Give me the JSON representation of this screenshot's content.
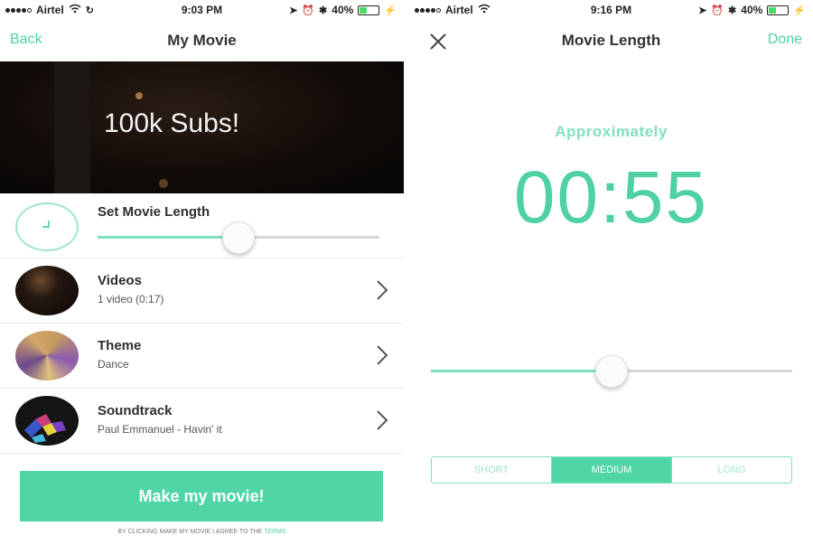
{
  "left": {
    "status": {
      "carrier": "Airtel",
      "time": "9:03 PM",
      "battery": "40%",
      "battery_level": 0.4
    },
    "nav": {
      "back_label": "Back",
      "title": "My Movie"
    },
    "hero": {
      "text": "100k Subs!"
    },
    "length": {
      "label": "Set Movie Length",
      "slider_value": 0.5,
      "icon": "clock-icon"
    },
    "rows": [
      {
        "title": "Videos",
        "subtitle": "1 video (0:17)",
        "icon": "chevron-right-icon"
      },
      {
        "title": "Theme",
        "subtitle": "Dance",
        "icon": "chevron-right-icon"
      },
      {
        "title": "Soundtrack",
        "subtitle": "Paul Emmanuel - Havin' it",
        "icon": "chevron-right-icon"
      }
    ],
    "make_button": "Make my movie!",
    "terms": {
      "text": "BY CLICKING MAKE MY MOVIE I AGREE TO THE",
      "link": "TERMS"
    }
  },
  "right": {
    "status": {
      "carrier": "Airtel",
      "time": "9:16 PM",
      "battery": "40%",
      "battery_level": 0.4
    },
    "nav": {
      "title": "Movie Length",
      "done_label": "Done",
      "close_icon": "close-icon"
    },
    "approx_label": "Approximately",
    "duration": "00:55",
    "slider_value": 0.5,
    "segments": [
      "SHORT",
      "MEDIUM",
      "LONG"
    ],
    "selected_segment": "MEDIUM"
  },
  "colors": {
    "accent": "#50d6a4",
    "accent_light": "#7fe0bd",
    "text": "#2e2e2e"
  }
}
